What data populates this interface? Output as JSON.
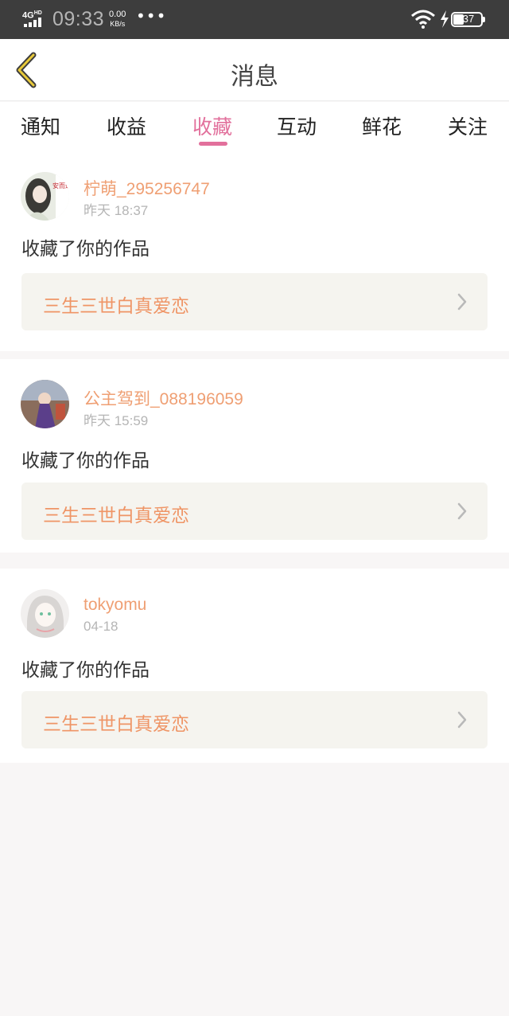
{
  "status_bar": {
    "network": "4G",
    "network_sup": "HD",
    "time": "09:33",
    "speed_value": "0.00",
    "speed_unit": "KB/s",
    "more": "•••",
    "battery": "37"
  },
  "header": {
    "title": "消息",
    "back_icon": "chevron-left-icon"
  },
  "tabs": [
    {
      "label": "通知",
      "active": false
    },
    {
      "label": "收益",
      "active": false
    },
    {
      "label": "收藏",
      "active": true
    },
    {
      "label": "互动",
      "active": false
    },
    {
      "label": "鲜花",
      "active": false
    },
    {
      "label": "关注",
      "active": false
    }
  ],
  "colors": {
    "accent": "#e2709c",
    "username": "#ef9f73",
    "work_title": "#ef9566",
    "work_bg": "#f5f4ef",
    "status_bar_bg": "#3d3d3d"
  },
  "messages": [
    {
      "username": "柠萌_295256747",
      "time": "昨天 18:37",
      "action": "收藏了你的作品",
      "work_title": "三生三世白真爱恋",
      "avatar_text": "安而逸"
    },
    {
      "username": "公主驾到_088196059",
      "time": "昨天 15:59",
      "action": "收藏了你的作品",
      "work_title": "三生三世白真爱恋"
    },
    {
      "username": "tokyomu",
      "time": "04-18",
      "action": "收藏了你的作品",
      "work_title": "三生三世白真爱恋"
    }
  ]
}
